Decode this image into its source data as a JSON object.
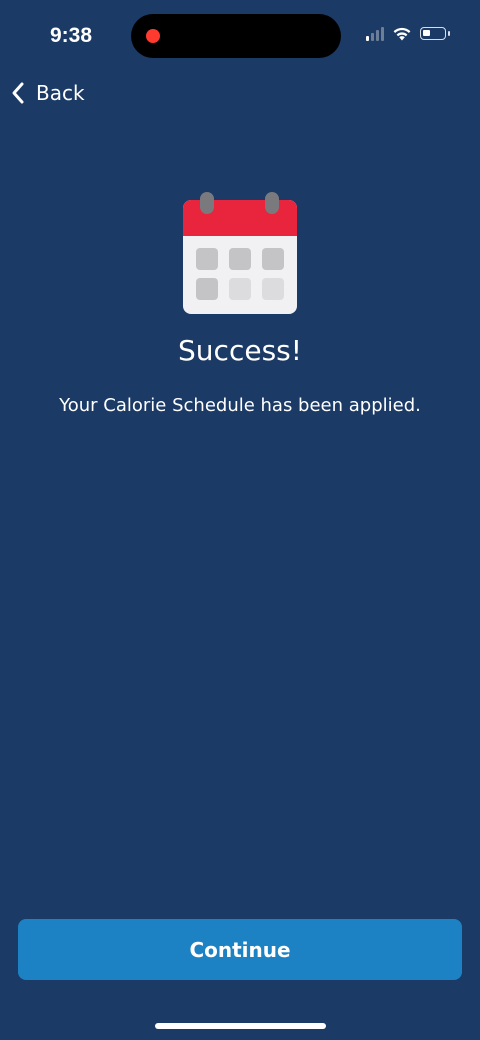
{
  "status_bar": {
    "time": "9:38",
    "icons": [
      "recording-dot-icon",
      "cellular-signal-icon",
      "wifi-icon",
      "battery-icon"
    ]
  },
  "nav": {
    "back_label": "Back",
    "back_icon": "chevron-left-icon"
  },
  "illustration": {
    "icon": "calendar-icon",
    "colors": {
      "header": "#e8253d",
      "body": "#f1f1f3",
      "rings": "#7a7a7e",
      "cells_dark": "#c4c4c7",
      "cells_light": "#dcdcdf"
    }
  },
  "content": {
    "title": "Success!",
    "message": "Your Calorie Schedule has been applied."
  },
  "actions": {
    "continue_label": "Continue"
  },
  "theme": {
    "background": "#1b3a66",
    "button": "#1c82c4"
  }
}
